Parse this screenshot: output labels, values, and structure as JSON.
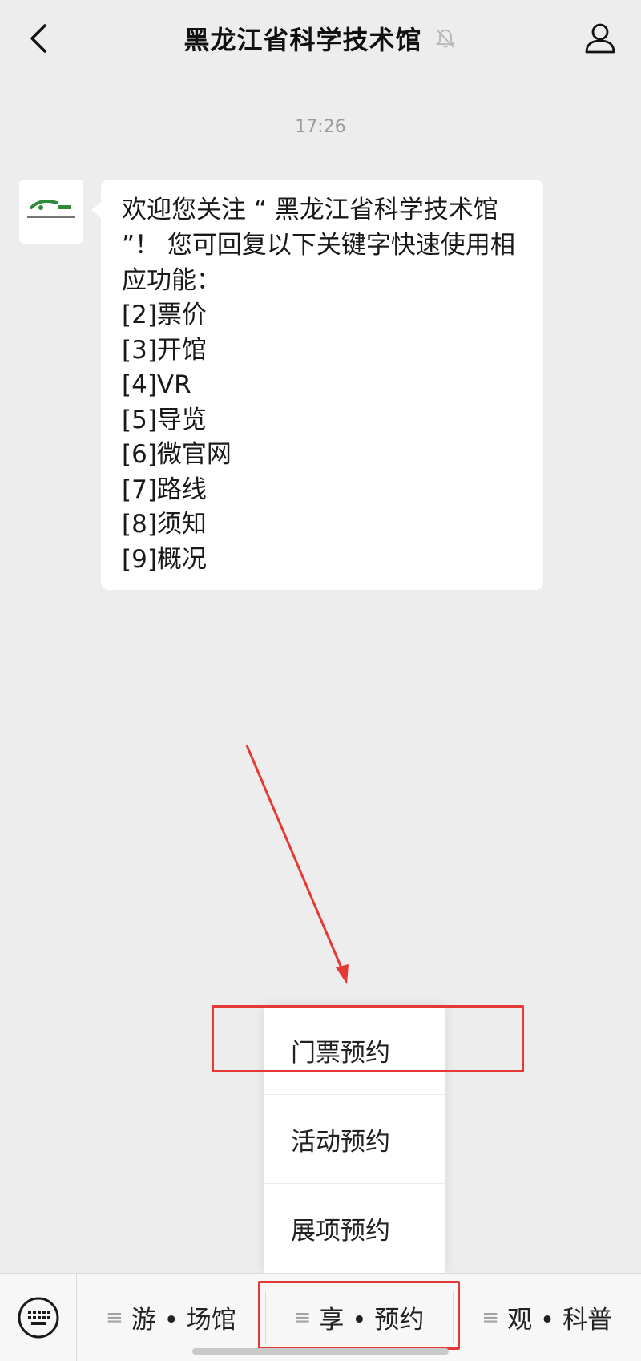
{
  "header": {
    "title": "黑龙江省科学技术馆"
  },
  "chat": {
    "timestamp": "17:26",
    "message": {
      "intro": "欢迎您关注 “ 黑龙江省科学技术馆 ”！ 您可回复以下关键字快速使用相应功能：",
      "items": [
        "[2]票价",
        "[3]开馆",
        "[4]VR",
        "[5]导览",
        "[6]微官网",
        "[7]路线",
        "[8]须知",
        "[9]概况"
      ]
    }
  },
  "popup_menu": {
    "items": [
      "门票预约",
      "活动预约",
      "展项预约"
    ]
  },
  "bottom_menu": {
    "tabs": [
      "游 • 场馆",
      "享 • 预约",
      "观 • 科普"
    ],
    "menu_glyph": "≡"
  },
  "colors": {
    "annotation": "#e53935",
    "logo_green": "#2e8b3a"
  },
  "icons": [
    "back-arrow-icon",
    "mute-bell-icon",
    "person-icon",
    "keyboard-icon"
  ]
}
